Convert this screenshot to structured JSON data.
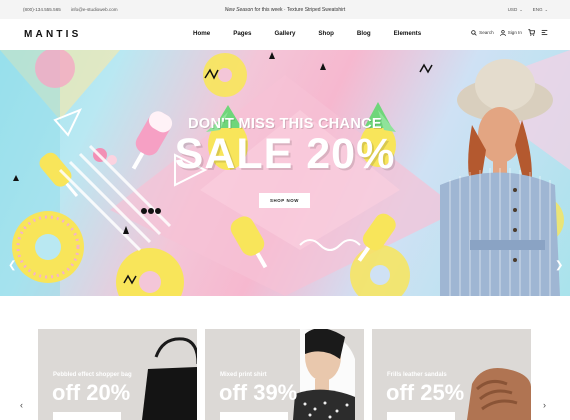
{
  "topbar": {
    "phone": "(800)-134.555.565",
    "email": "info@e-studioweb.com",
    "promo_italic": "New Season",
    "promo_rest": " for this week · Texture Striped Sweatshirt",
    "currency": "USD",
    "language": "ENG"
  },
  "header": {
    "logo": "MANTIS",
    "nav": [
      "Home",
      "Pages",
      "Gallery",
      "Shop",
      "Blog",
      "Elements"
    ],
    "search_label": "Search",
    "signin_label": "Sign In"
  },
  "hero": {
    "overline": "DON'T MISS THIS CHANCE",
    "headline": "SALE 20%",
    "button": "SHOP NOW"
  },
  "products": [
    {
      "caption": "Pebbled effect shopper bag",
      "discount": "off 20%"
    },
    {
      "caption": "Mixed print shirt",
      "discount": "off 39%"
    },
    {
      "caption": "Frills leather sandals",
      "discount": "off 25%"
    }
  ],
  "icons": {
    "prev": "chevron-left-icon",
    "next": "chevron-right-icon"
  },
  "colors": {
    "hero_pink": "#f6b8cf",
    "hero_cyan": "#9fe3ee",
    "card_bg": "#dcd9d6"
  }
}
